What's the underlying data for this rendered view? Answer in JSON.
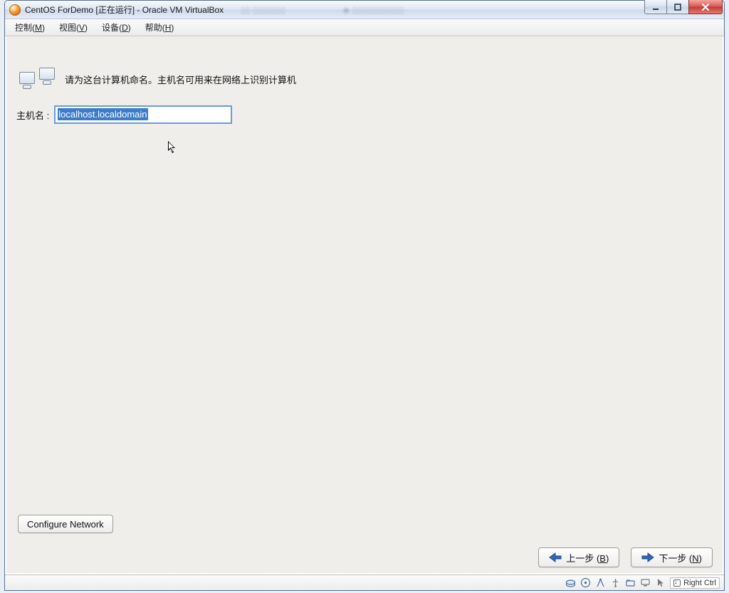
{
  "window": {
    "title": "CentOS ForDemo [正在运行] - Oracle VM VirtualBox"
  },
  "menubar": {
    "control": {
      "label": "控制",
      "accel": "M"
    },
    "view": {
      "label": "视图",
      "accel": "V"
    },
    "devices": {
      "label": "设备",
      "accel": "D"
    },
    "help": {
      "label": "帮助",
      "accel": "H"
    }
  },
  "header": {
    "text": "请为这台计算机命名。主机名可用来在网络上识别计算机"
  },
  "hostname": {
    "label": "主机名 :",
    "value": "localhost.localdomain"
  },
  "buttons": {
    "configure_network": "Configure Network",
    "back_label": "上一步 (",
    "back_accel": "B",
    "back_tail": ")",
    "next_label": "下一步 (",
    "next_accel": "N",
    "next_tail": ")"
  },
  "statusbar": {
    "hostkey": "Right Ctrl"
  }
}
